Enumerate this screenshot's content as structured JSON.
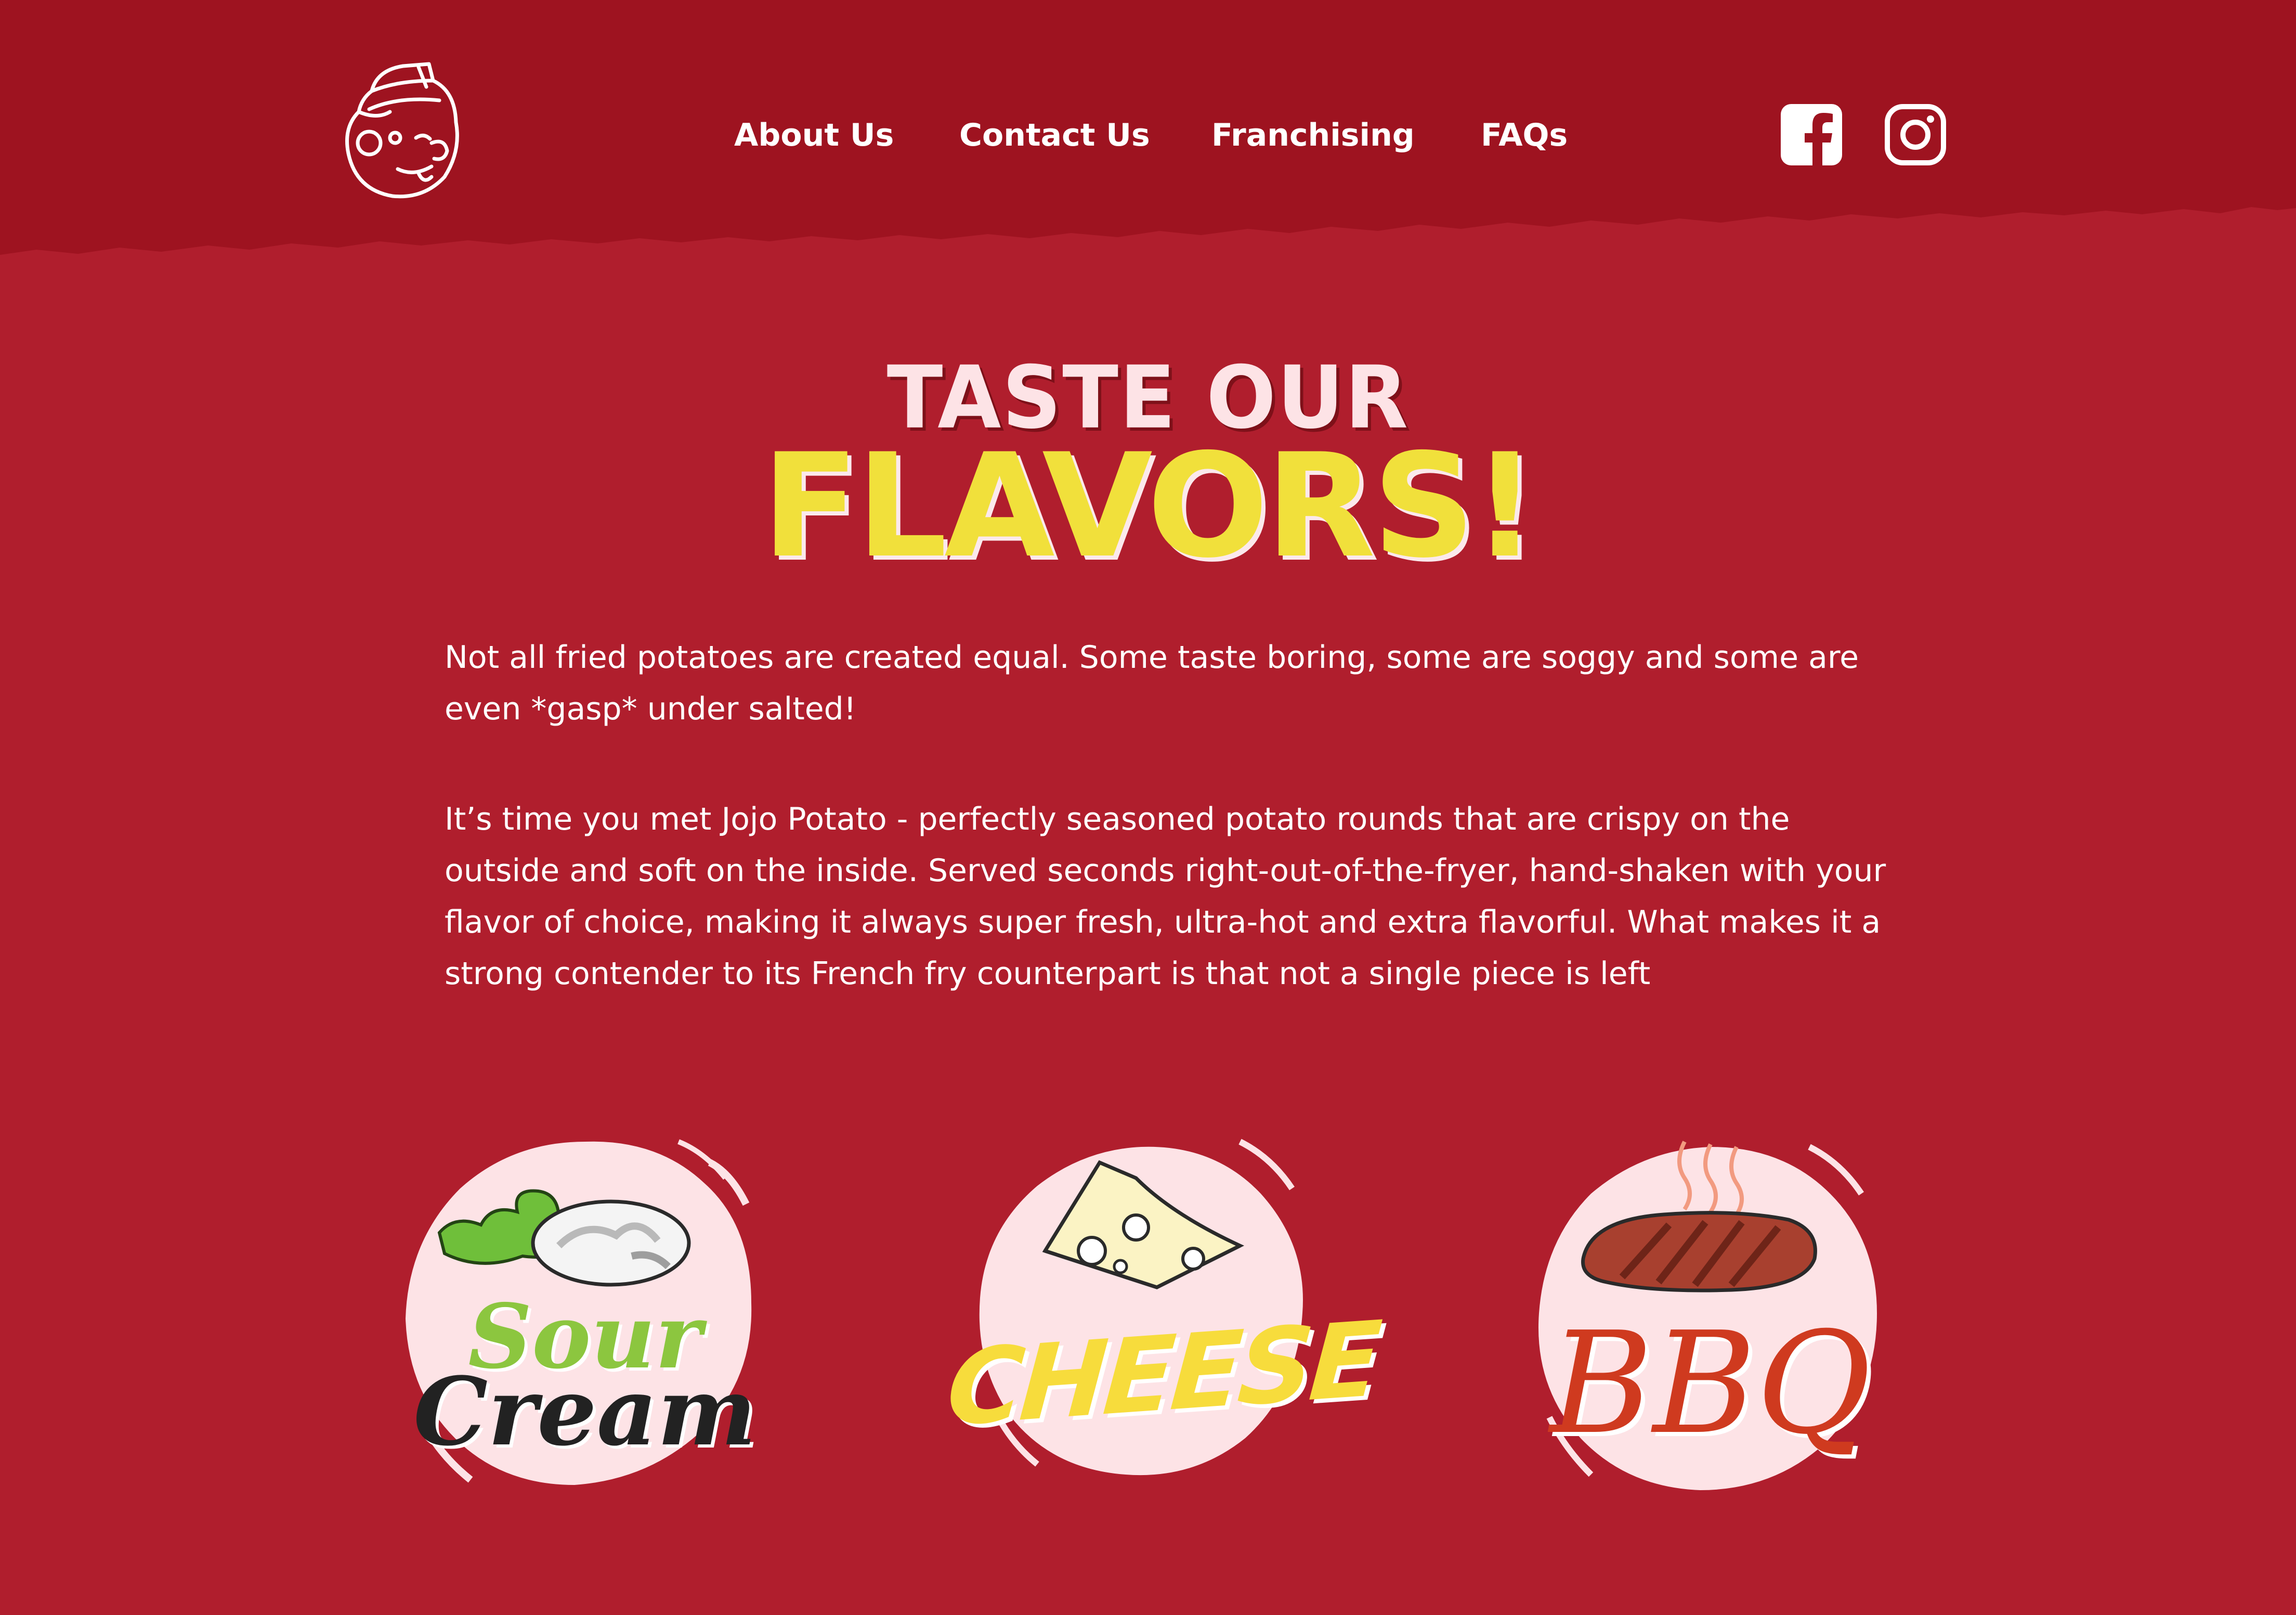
{
  "colors": {
    "header_bg": "#9e1320",
    "page_bg": "#b01e2d",
    "headline_top": "#fde3e6",
    "headline_main": "#f1e03b",
    "text": "#ffffff",
    "badge_bg": "#fde3e6",
    "sour_green": "#8cc63f",
    "cheese_yellow": "#f7dc3c",
    "bbq_red": "#cf3a1f"
  },
  "header": {
    "logo_icon": "jojo-potato-mascot-icon",
    "nav": [
      {
        "label": "About Us"
      },
      {
        "label": "Contact Us"
      },
      {
        "label": "Franchising"
      },
      {
        "label": "FAQs"
      }
    ],
    "social": [
      {
        "icon": "facebook-icon"
      },
      {
        "icon": "instagram-icon"
      }
    ]
  },
  "headline": {
    "line1": "TASTE OUR",
    "line2": "FLAVORS!"
  },
  "copy": {
    "paragraph1": "Not all fried potatoes are created equal. Some taste boring, some are soggy and some are even *gasp* under salted!",
    "paragraph2": "It’s time you met Jojo Potato - perfectly seasoned potato rounds that are crispy on the outside and soft on the inside. Served seconds right-out-of-the-fryer, hand-shaken with your flavor of choice, making it always super fresh, ultra-hot and extra flavorful. What makes it a strong contender to its French fry counterpart is that not a single piece is left"
  },
  "flavors": [
    {
      "word1": "Sour",
      "word2": "Cream",
      "icon": "sour-cream-dollop-icon"
    },
    {
      "word1": "CHEESE",
      "icon": "cheese-wedge-icon"
    },
    {
      "word1": "BBQ",
      "icon": "steak-icon"
    }
  ]
}
